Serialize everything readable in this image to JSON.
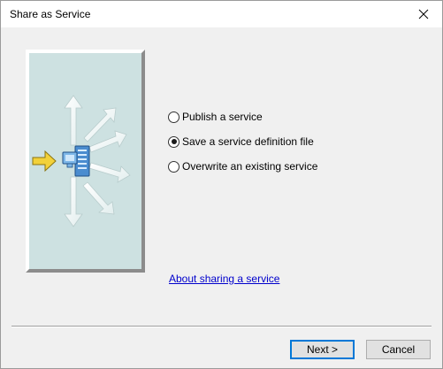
{
  "window": {
    "title": "Share as Service",
    "close_icon": "close-icon"
  },
  "illustration": {
    "icon": "share-service-illustration",
    "bg_color": "#cde1e1"
  },
  "options": [
    {
      "label": "Publish a service",
      "selected": false
    },
    {
      "label": "Save a service definition file",
      "selected": true
    },
    {
      "label": "Overwrite an existing service",
      "selected": false
    }
  ],
  "link": {
    "label": "About sharing a service"
  },
  "buttons": {
    "next": "Next >",
    "cancel": "Cancel"
  },
  "colors": {
    "accent": "#0078d7",
    "link": "#0000cc",
    "arrow_yellow": "#f2d13a"
  }
}
